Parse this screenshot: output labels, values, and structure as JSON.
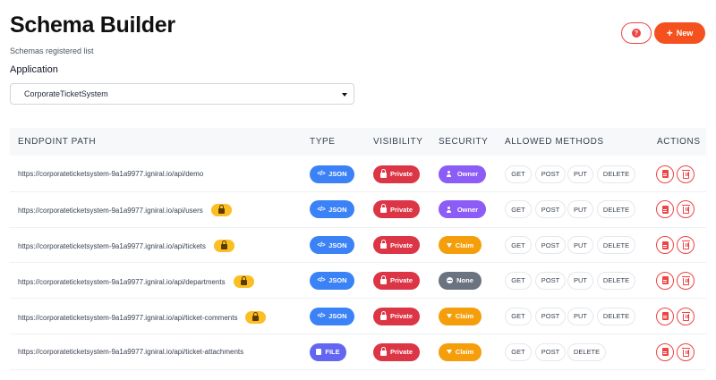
{
  "header": {
    "title": "Schema Builder",
    "subtitle": "Schemas registered list",
    "help_icon_glyph": "?",
    "new_label": "New"
  },
  "application": {
    "label": "Application",
    "selected": "CorporateTicketSystem"
  },
  "table": {
    "columns": [
      "ENDPOINT PATH",
      "TYPE",
      "VISIBILITY",
      "SECURITY",
      "ALLOWED METHODS",
      "ACTIONS"
    ],
    "rows": [
      {
        "path": "https://corporateticketsystem-9a1a9977.igniral.io/api/demo",
        "locked": false,
        "type": "JSON",
        "visibility": "Private",
        "security": "Owner",
        "methods": [
          "GET",
          "POST",
          "PUT",
          "DELETE"
        ]
      },
      {
        "path": "https://corporateticketsystem-9a1a9977.igniral.io/api/users",
        "locked": true,
        "type": "JSON",
        "visibility": "Private",
        "security": "Owner",
        "methods": [
          "GET",
          "POST",
          "PUT",
          "DELETE"
        ]
      },
      {
        "path": "https://corporateticketsystem-9a1a9977.igniral.io/api/tickets",
        "locked": true,
        "type": "JSON",
        "visibility": "Private",
        "security": "Claim",
        "methods": [
          "GET",
          "POST",
          "PUT",
          "DELETE"
        ]
      },
      {
        "path": "https://corporateticketsystem-9a1a9977.igniral.io/api/departments",
        "locked": true,
        "type": "JSON",
        "visibility": "Private",
        "security": "None",
        "methods": [
          "GET",
          "POST",
          "PUT",
          "DELETE"
        ]
      },
      {
        "path": "https://corporateticketsystem-9a1a9977.igniral.io/api/ticket-comments",
        "locked": true,
        "type": "JSON",
        "visibility": "Private",
        "security": "Claim",
        "methods": [
          "GET",
          "POST",
          "PUT",
          "DELETE"
        ]
      },
      {
        "path": "https://corporateticketsystem-9a1a9977.igniral.io/api/ticket-attachments",
        "locked": false,
        "type": "FILE",
        "visibility": "Private",
        "security": "Claim",
        "methods": [
          "GET",
          "POST",
          "DELETE"
        ]
      }
    ]
  },
  "colors": {
    "accent": "#f4511e",
    "json": "#3b82f6",
    "file": "#6366f1",
    "private": "#dc3545",
    "owner": "#8b5cf6",
    "claim": "#f59e0b",
    "none": "#6b7280",
    "lock": "#fbbf24"
  }
}
